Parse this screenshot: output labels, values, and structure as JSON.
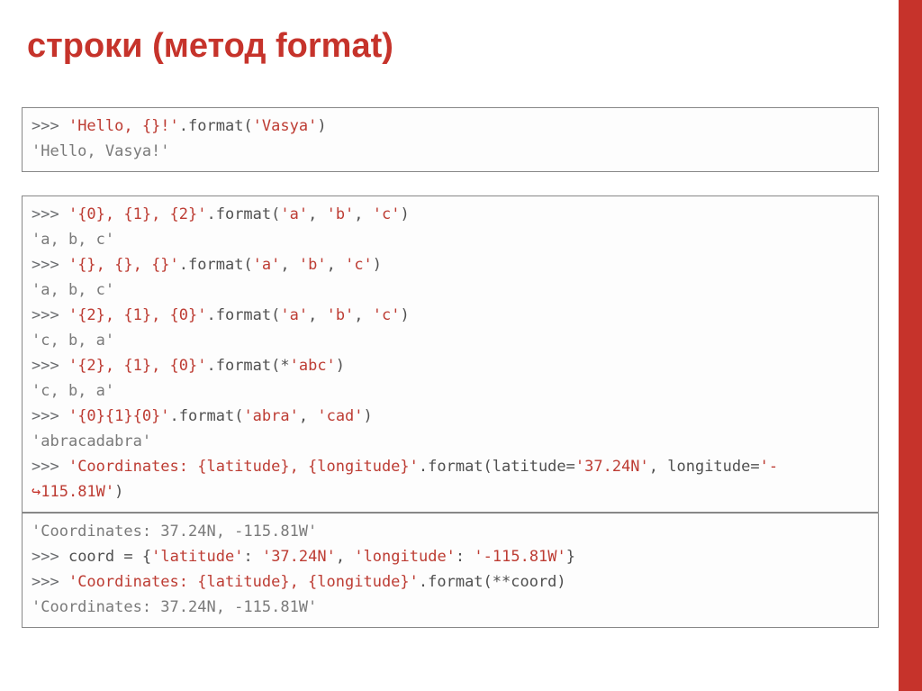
{
  "title": "строки (метод format)",
  "box1": {
    "l1_prompt": ">>> ",
    "l1_a": "'Hello, {}!'",
    "l1_b": ".format(",
    "l1_c": "'Vasya'",
    "l1_d": ")",
    "l2": "'Hello, Vasya!'"
  },
  "box2": {
    "l1_prompt": ">>> ",
    "l1_a": "'{0}, {1}, {2}'",
    "l1_b": ".format(",
    "l1_c": "'a'",
    "l1_d": ", ",
    "l1_e": "'b'",
    "l1_f": ", ",
    "l1_g": "'c'",
    "l1_h": ")",
    "l2": "'a, b, c'",
    "l3_prompt": ">>> ",
    "l3_a": "'{}, {}, {}'",
    "l3_b": ".format(",
    "l3_c": "'a'",
    "l3_d": ", ",
    "l3_e": "'b'",
    "l3_f": ", ",
    "l3_g": "'c'",
    "l3_h": ")",
    "l4": "'a, b, c'",
    "l5_prompt": ">>> ",
    "l5_a": "'{2}, {1}, {0}'",
    "l5_b": ".format(",
    "l5_c": "'a'",
    "l5_d": ", ",
    "l5_e": "'b'",
    "l5_f": ", ",
    "l5_g": "'c'",
    "l5_h": ")",
    "l6": "'c, b, a'",
    "l7_prompt": ">>> ",
    "l7_a": "'{2}, {1}, {0}'",
    "l7_b": ".format(*",
    "l7_c": "'abc'",
    "l7_d": ")",
    "l8": "'c, b, a'",
    "l9_prompt": ">>> ",
    "l9_a": "'{0}{1}{0}'",
    "l9_b": ".format(",
    "l9_c": "'abra'",
    "l9_d": ", ",
    "l9_e": "'cad'",
    "l9_f": ")",
    "l10": "'abracadabra'",
    "l11_prompt": ">>> ",
    "l11_a": "'Coordinates: {latitude}, {longitude}'",
    "l11_b": ".format(latitude=",
    "l11_c": "'37.24N'",
    "l11_d": ", longitude=",
    "l11_e": "'-",
    "l12_cont": "↪",
    "l12_a": "115.81W'",
    "l12_b": ")"
  },
  "box3": {
    "l1": "'Coordinates: 37.24N, -115.81W'",
    "l2_prompt": ">>> ",
    "l2_a": "coord ",
    "l2_b": "= ",
    "l2_c": "{",
    "l2_d": "'latitude'",
    "l2_e": ": ",
    "l2_f": "'37.24N'",
    "l2_g": ", ",
    "l2_h": "'longitude'",
    "l2_i": ": ",
    "l2_j": "'-115.81W'",
    "l2_k": "}",
    "l3_prompt": ">>> ",
    "l3_a": "'Coordinates: {latitude}, {longitude}'",
    "l3_b": ".format(**coord)",
    "l4": "'Coordinates: 37.24N, -115.81W'"
  }
}
